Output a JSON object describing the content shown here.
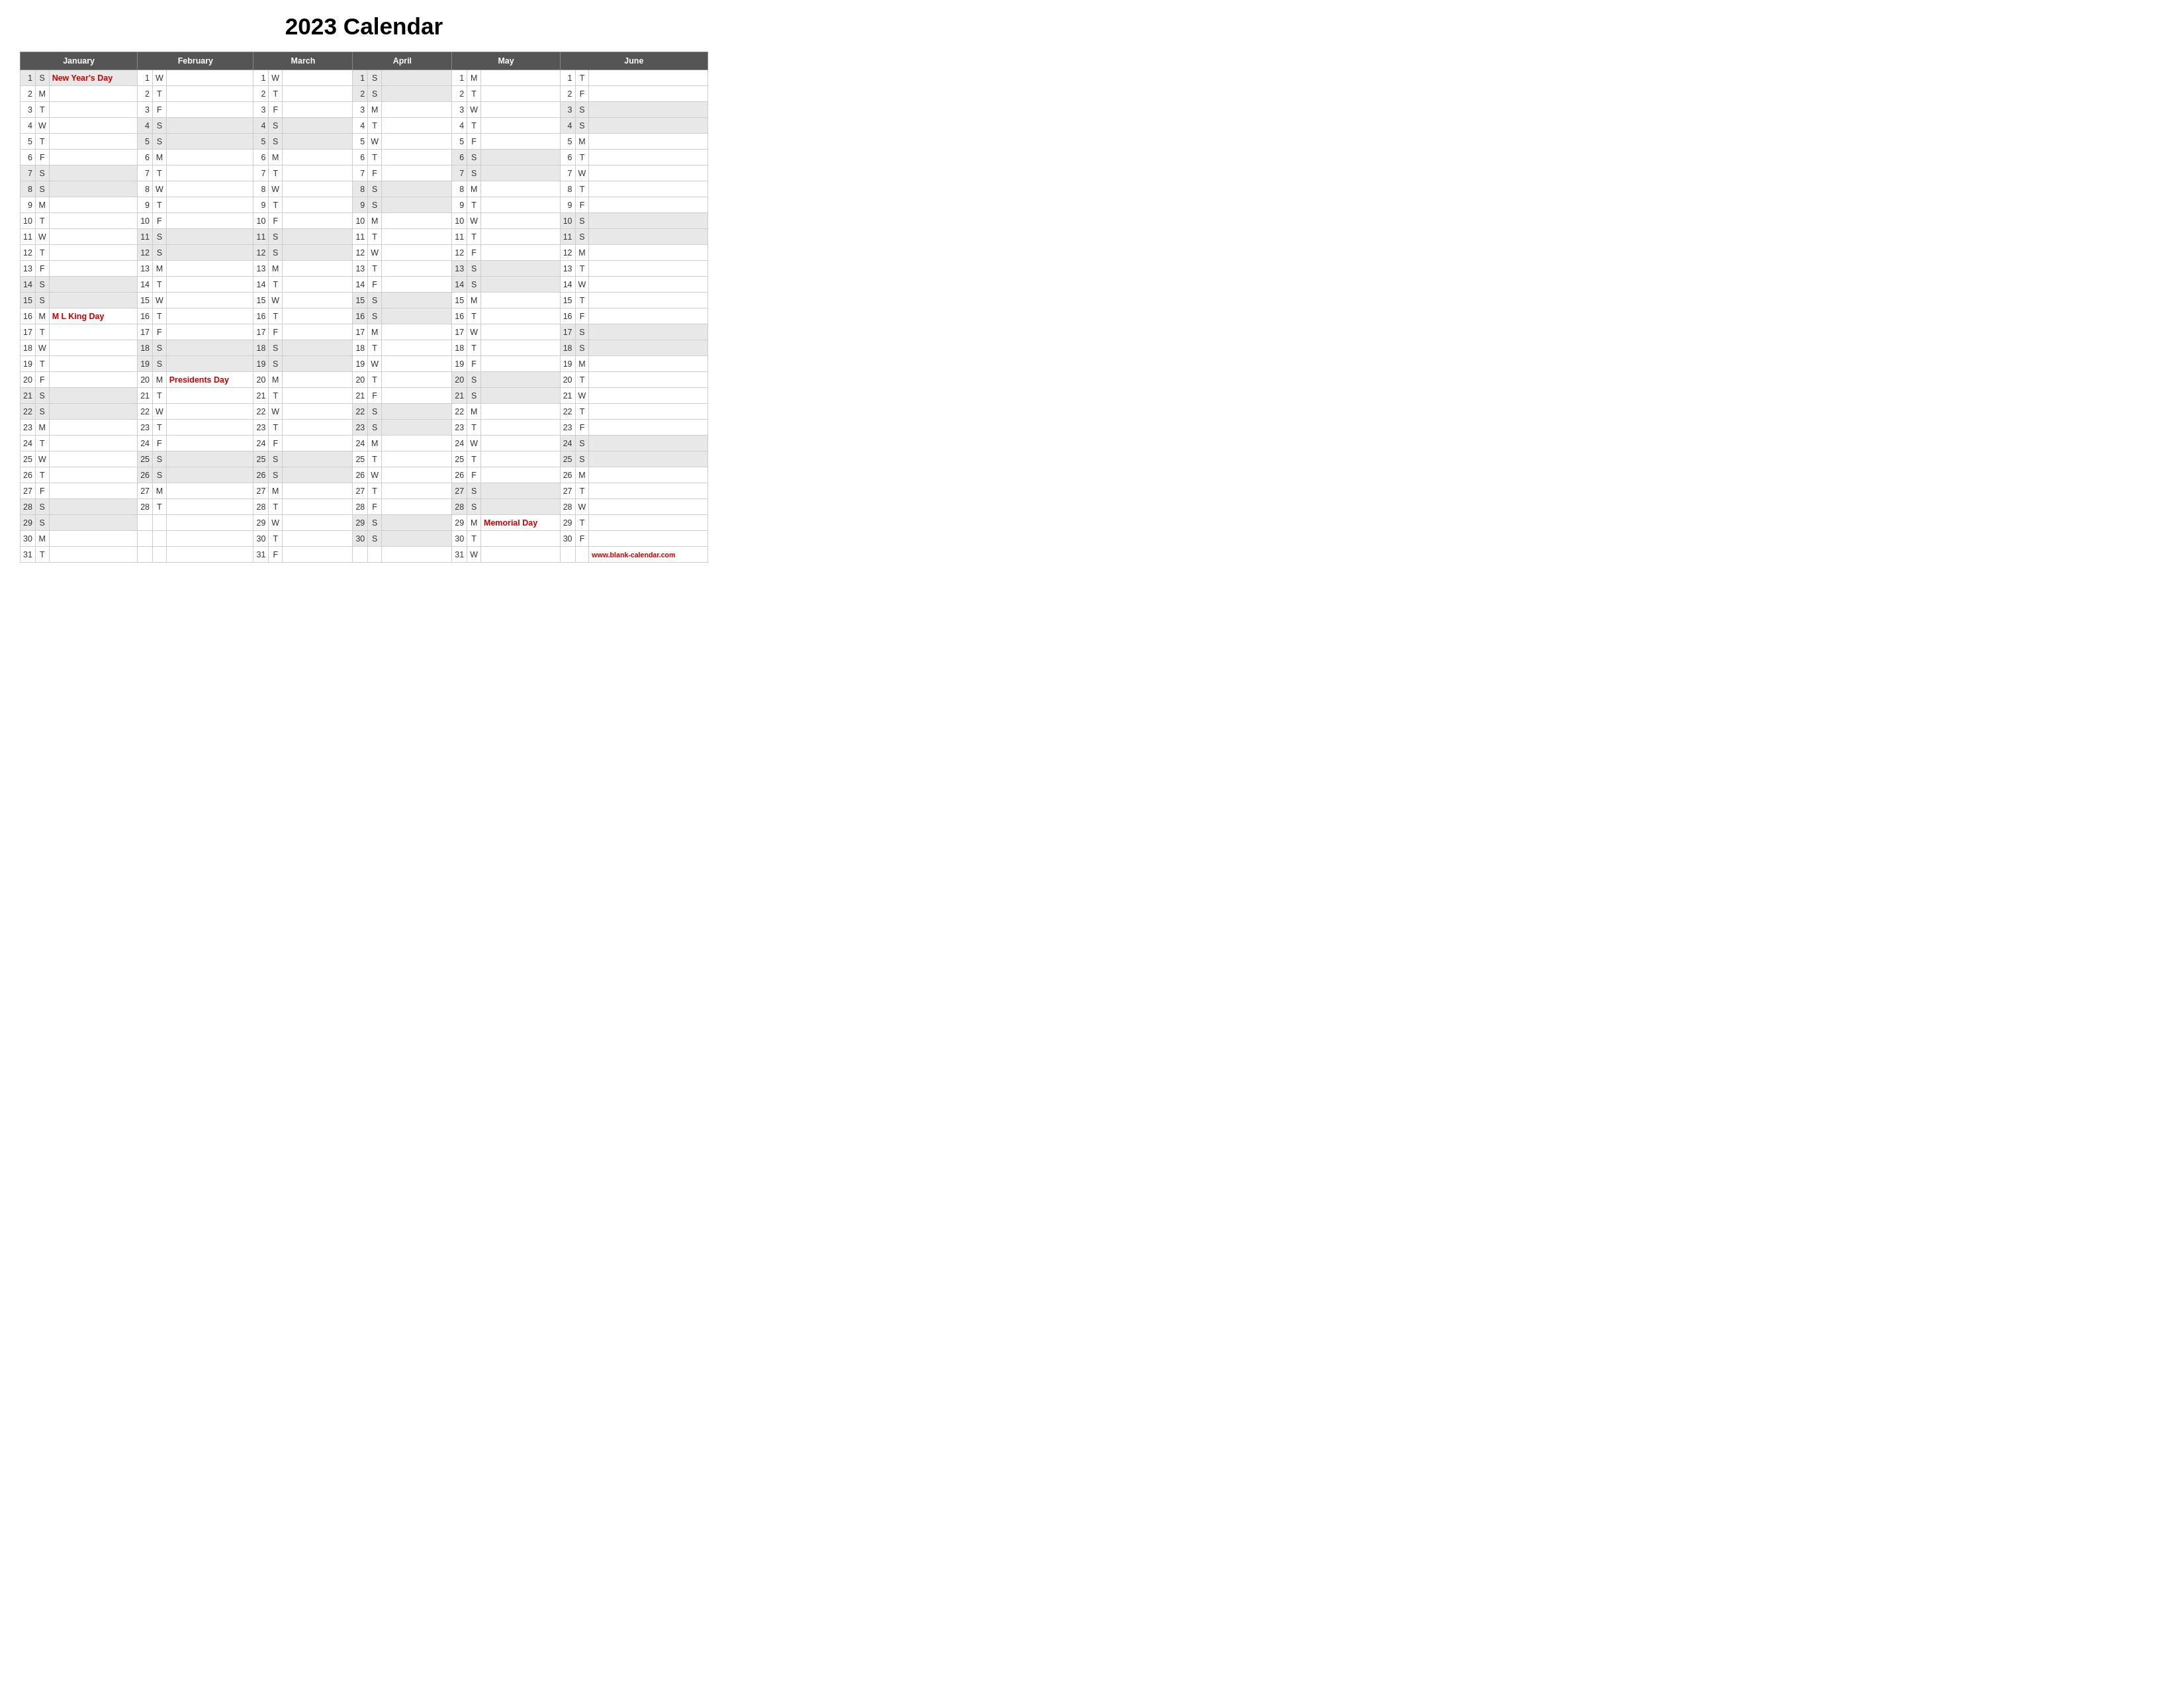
{
  "title": "2023 Calendar",
  "months": [
    "January",
    "February",
    "March",
    "April",
    "May",
    "June"
  ],
  "footer": "www.blank-calendar.com",
  "holidays": {
    "jan_1": "New Year's Day",
    "jan_16": "M L King Day",
    "feb_20": "Presidents Day",
    "may_29": "Memorial Day"
  },
  "days": {
    "january": [
      {
        "d": 1,
        "w": "S"
      },
      {
        "d": 2,
        "w": "M"
      },
      {
        "d": 3,
        "w": "T"
      },
      {
        "d": 4,
        "w": "W"
      },
      {
        "d": 5,
        "w": "T"
      },
      {
        "d": 6,
        "w": "F"
      },
      {
        "d": 7,
        "w": "S"
      },
      {
        "d": 8,
        "w": "S"
      },
      {
        "d": 9,
        "w": "M"
      },
      {
        "d": 10,
        "w": "T"
      },
      {
        "d": 11,
        "w": "W"
      },
      {
        "d": 12,
        "w": "T"
      },
      {
        "d": 13,
        "w": "F"
      },
      {
        "d": 14,
        "w": "S"
      },
      {
        "d": 15,
        "w": "S"
      },
      {
        "d": 16,
        "w": "M"
      },
      {
        "d": 17,
        "w": "T"
      },
      {
        "d": 18,
        "w": "W"
      },
      {
        "d": 19,
        "w": "T"
      },
      {
        "d": 20,
        "w": "F"
      },
      {
        "d": 21,
        "w": "S"
      },
      {
        "d": 22,
        "w": "S"
      },
      {
        "d": 23,
        "w": "M"
      },
      {
        "d": 24,
        "w": "T"
      },
      {
        "d": 25,
        "w": "W"
      },
      {
        "d": 26,
        "w": "T"
      },
      {
        "d": 27,
        "w": "F"
      },
      {
        "d": 28,
        "w": "S"
      },
      {
        "d": 29,
        "w": "S"
      },
      {
        "d": 30,
        "w": "M"
      },
      {
        "d": 31,
        "w": "T"
      }
    ],
    "february": [
      {
        "d": 1,
        "w": "W"
      },
      {
        "d": 2,
        "w": "T"
      },
      {
        "d": 3,
        "w": "F"
      },
      {
        "d": 4,
        "w": "S"
      },
      {
        "d": 5,
        "w": "S"
      },
      {
        "d": 6,
        "w": "M"
      },
      {
        "d": 7,
        "w": "T"
      },
      {
        "d": 8,
        "w": "W"
      },
      {
        "d": 9,
        "w": "T"
      },
      {
        "d": 10,
        "w": "F"
      },
      {
        "d": 11,
        "w": "S"
      },
      {
        "d": 12,
        "w": "S"
      },
      {
        "d": 13,
        "w": "M"
      },
      {
        "d": 14,
        "w": "T"
      },
      {
        "d": 15,
        "w": "W"
      },
      {
        "d": 16,
        "w": "T"
      },
      {
        "d": 17,
        "w": "F"
      },
      {
        "d": 18,
        "w": "S"
      },
      {
        "d": 19,
        "w": "S"
      },
      {
        "d": 20,
        "w": "M"
      },
      {
        "d": 21,
        "w": "T"
      },
      {
        "d": 22,
        "w": "W"
      },
      {
        "d": 23,
        "w": "T"
      },
      {
        "d": 24,
        "w": "F"
      },
      {
        "d": 25,
        "w": "S"
      },
      {
        "d": 26,
        "w": "S"
      },
      {
        "d": 27,
        "w": "M"
      },
      {
        "d": 28,
        "w": "T"
      }
    ],
    "march": [
      {
        "d": 1,
        "w": "W"
      },
      {
        "d": 2,
        "w": "T"
      },
      {
        "d": 3,
        "w": "F"
      },
      {
        "d": 4,
        "w": "S"
      },
      {
        "d": 5,
        "w": "S"
      },
      {
        "d": 6,
        "w": "M"
      },
      {
        "d": 7,
        "w": "T"
      },
      {
        "d": 8,
        "w": "W"
      },
      {
        "d": 9,
        "w": "T"
      },
      {
        "d": 10,
        "w": "F"
      },
      {
        "d": 11,
        "w": "S"
      },
      {
        "d": 12,
        "w": "S"
      },
      {
        "d": 13,
        "w": "M"
      },
      {
        "d": 14,
        "w": "T"
      },
      {
        "d": 15,
        "w": "W"
      },
      {
        "d": 16,
        "w": "T"
      },
      {
        "d": 17,
        "w": "F"
      },
      {
        "d": 18,
        "w": "S"
      },
      {
        "d": 19,
        "w": "S"
      },
      {
        "d": 20,
        "w": "M"
      },
      {
        "d": 21,
        "w": "T"
      },
      {
        "d": 22,
        "w": "W"
      },
      {
        "d": 23,
        "w": "T"
      },
      {
        "d": 24,
        "w": "F"
      },
      {
        "d": 25,
        "w": "S"
      },
      {
        "d": 26,
        "w": "S"
      },
      {
        "d": 27,
        "w": "M"
      },
      {
        "d": 28,
        "w": "T"
      },
      {
        "d": 29,
        "w": "W"
      },
      {
        "d": 30,
        "w": "T"
      },
      {
        "d": 31,
        "w": "F"
      }
    ],
    "april": [
      {
        "d": 1,
        "w": "S"
      },
      {
        "d": 2,
        "w": "S"
      },
      {
        "d": 3,
        "w": "M"
      },
      {
        "d": 4,
        "w": "T"
      },
      {
        "d": 5,
        "w": "W"
      },
      {
        "d": 6,
        "w": "T"
      },
      {
        "d": 7,
        "w": "F"
      },
      {
        "d": 8,
        "w": "S"
      },
      {
        "d": 9,
        "w": "S"
      },
      {
        "d": 10,
        "w": "M"
      },
      {
        "d": 11,
        "w": "T"
      },
      {
        "d": 12,
        "w": "W"
      },
      {
        "d": 13,
        "w": "T"
      },
      {
        "d": 14,
        "w": "F"
      },
      {
        "d": 15,
        "w": "S"
      },
      {
        "d": 16,
        "w": "S"
      },
      {
        "d": 17,
        "w": "M"
      },
      {
        "d": 18,
        "w": "T"
      },
      {
        "d": 19,
        "w": "W"
      },
      {
        "d": 20,
        "w": "T"
      },
      {
        "d": 21,
        "w": "F"
      },
      {
        "d": 22,
        "w": "S"
      },
      {
        "d": 23,
        "w": "S"
      },
      {
        "d": 24,
        "w": "M"
      },
      {
        "d": 25,
        "w": "T"
      },
      {
        "d": 26,
        "w": "W"
      },
      {
        "d": 27,
        "w": "T"
      },
      {
        "d": 28,
        "w": "F"
      },
      {
        "d": 29,
        "w": "S"
      },
      {
        "d": 30,
        "w": "S"
      }
    ],
    "may": [
      {
        "d": 1,
        "w": "M"
      },
      {
        "d": 2,
        "w": "T"
      },
      {
        "d": 3,
        "w": "W"
      },
      {
        "d": 4,
        "w": "T"
      },
      {
        "d": 5,
        "w": "F"
      },
      {
        "d": 6,
        "w": "S"
      },
      {
        "d": 7,
        "w": "S"
      },
      {
        "d": 8,
        "w": "M"
      },
      {
        "d": 9,
        "w": "T"
      },
      {
        "d": 10,
        "w": "W"
      },
      {
        "d": 11,
        "w": "T"
      },
      {
        "d": 12,
        "w": "F"
      },
      {
        "d": 13,
        "w": "S"
      },
      {
        "d": 14,
        "w": "S"
      },
      {
        "d": 15,
        "w": "M"
      },
      {
        "d": 16,
        "w": "T"
      },
      {
        "d": 17,
        "w": "W"
      },
      {
        "d": 18,
        "w": "T"
      },
      {
        "d": 19,
        "w": "F"
      },
      {
        "d": 20,
        "w": "S"
      },
      {
        "d": 21,
        "w": "S"
      },
      {
        "d": 22,
        "w": "M"
      },
      {
        "d": 23,
        "w": "T"
      },
      {
        "d": 24,
        "w": "W"
      },
      {
        "d": 25,
        "w": "T"
      },
      {
        "d": 26,
        "w": "F"
      },
      {
        "d": 27,
        "w": "S"
      },
      {
        "d": 28,
        "w": "S"
      },
      {
        "d": 29,
        "w": "M"
      },
      {
        "d": 30,
        "w": "T"
      },
      {
        "d": 31,
        "w": "W"
      }
    ],
    "june": [
      {
        "d": 1,
        "w": "T"
      },
      {
        "d": 2,
        "w": "F"
      },
      {
        "d": 3,
        "w": "S"
      },
      {
        "d": 4,
        "w": "S"
      },
      {
        "d": 5,
        "w": "M"
      },
      {
        "d": 6,
        "w": "T"
      },
      {
        "d": 7,
        "w": "W"
      },
      {
        "d": 8,
        "w": "T"
      },
      {
        "d": 9,
        "w": "F"
      },
      {
        "d": 10,
        "w": "S"
      },
      {
        "d": 11,
        "w": "S"
      },
      {
        "d": 12,
        "w": "M"
      },
      {
        "d": 13,
        "w": "T"
      },
      {
        "d": 14,
        "w": "W"
      },
      {
        "d": 15,
        "w": "T"
      },
      {
        "d": 16,
        "w": "F"
      },
      {
        "d": 17,
        "w": "S"
      },
      {
        "d": 18,
        "w": "S"
      },
      {
        "d": 19,
        "w": "M"
      },
      {
        "d": 20,
        "w": "T"
      },
      {
        "d": 21,
        "w": "W"
      },
      {
        "d": 22,
        "w": "T"
      },
      {
        "d": 23,
        "w": "F"
      },
      {
        "d": 24,
        "w": "S"
      },
      {
        "d": 25,
        "w": "S"
      },
      {
        "d": 26,
        "w": "M"
      },
      {
        "d": 27,
        "w": "T"
      },
      {
        "d": 28,
        "w": "W"
      },
      {
        "d": 29,
        "w": "T"
      },
      {
        "d": 30,
        "w": "F"
      }
    ]
  }
}
